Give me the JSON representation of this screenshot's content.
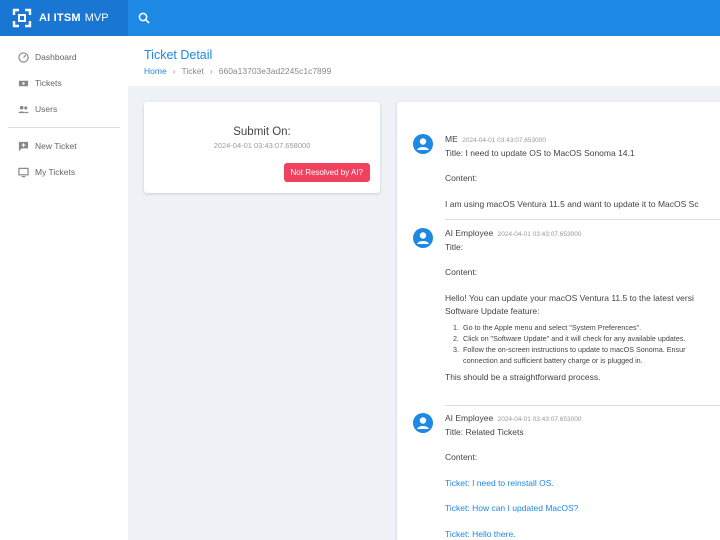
{
  "app": {
    "brand": "AI ITSM",
    "brand_suffix": "MVP"
  },
  "sidebar": {
    "items": [
      {
        "label": "Dashboard",
        "icon": "dashboard-icon"
      },
      {
        "label": "Tickets",
        "icon": "ticket-icon"
      },
      {
        "label": "Users",
        "icon": "users-icon"
      }
    ],
    "secondary": [
      {
        "label": "New Ticket",
        "icon": "new-ticket-icon"
      },
      {
        "label": "My Tickets",
        "icon": "my-tickets-icon"
      }
    ]
  },
  "header": {
    "title": "Ticket Detail",
    "breadcrumb": [
      "Home",
      "Ticket",
      "660a13703e3ad2245c1c7899"
    ]
  },
  "submit": {
    "title": "Submit On:",
    "timestamp": "2024-04-01 03:43:07.658000",
    "button": "Not Resolved by AI?"
  },
  "messages": [
    {
      "author": "ME",
      "timestamp": "2024-04-01 03:43:07.653000",
      "title": "Title: I need to update OS to MacOS Sonoma 14.1",
      "content_label": "Content:",
      "content": "I am using macOS Ventura 11.5 and want to update it to MacOS Sc"
    },
    {
      "author": "AI Employee",
      "timestamp": "2024-04-01 03:43:07.653000",
      "title": "Title:",
      "content_label": "Content:",
      "content_line1": "Hello! You can update your macOS Ventura 11.5 to the latest versi",
      "content_line2": "Software Update feature:",
      "steps": [
        "Go to the Apple menu and select \"System Preferences\".",
        "Click on \"Software Update\" and it will check for any available updates.",
        "Follow the on-screen instructions to update to macOS Sonoma. Ensur",
        "connection and sufficient battery charge or is plugged in."
      ],
      "closing": "This should be a straightforward process."
    },
    {
      "author": "AI Employee",
      "timestamp": "2024-04-01 03:43:07.653000",
      "title": "Title: Related Tickets",
      "content_label": "Content:",
      "links": [
        "Ticket: I need to reinstall OS.",
        "Ticket: How can I updated MacOS?",
        "Ticket: Hello there."
      ]
    }
  ],
  "colors": {
    "primary": "#1e88e5",
    "brand_bg": "#1976d2",
    "danger": "#f0415e"
  }
}
